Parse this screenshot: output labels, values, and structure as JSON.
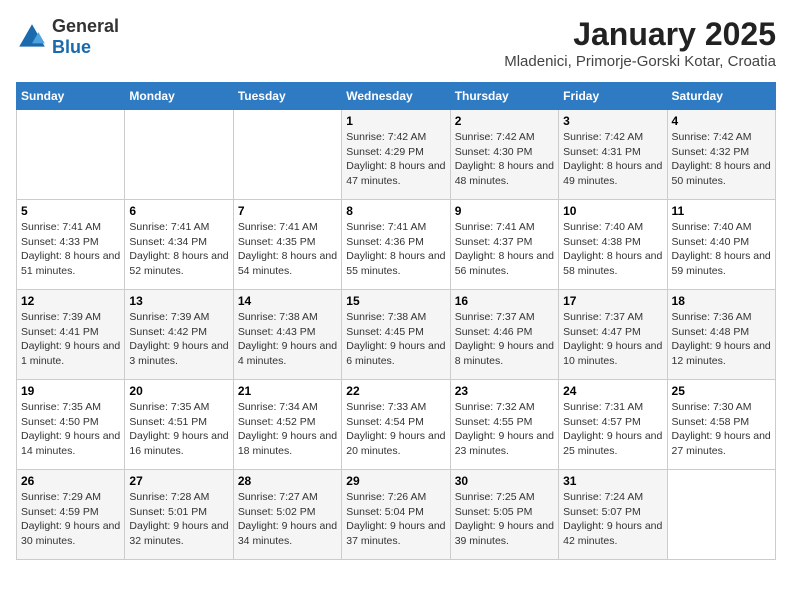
{
  "header": {
    "logo_general": "General",
    "logo_blue": "Blue",
    "month_title": "January 2025",
    "location": "Mladenici, Primorje-Gorski Kotar, Croatia"
  },
  "weekdays": [
    "Sunday",
    "Monday",
    "Tuesday",
    "Wednesday",
    "Thursday",
    "Friday",
    "Saturday"
  ],
  "weeks": [
    [
      {
        "day": "",
        "content": ""
      },
      {
        "day": "",
        "content": ""
      },
      {
        "day": "",
        "content": ""
      },
      {
        "day": "1",
        "content": "Sunrise: 7:42 AM\nSunset: 4:29 PM\nDaylight: 8 hours and 47 minutes."
      },
      {
        "day": "2",
        "content": "Sunrise: 7:42 AM\nSunset: 4:30 PM\nDaylight: 8 hours and 48 minutes."
      },
      {
        "day": "3",
        "content": "Sunrise: 7:42 AM\nSunset: 4:31 PM\nDaylight: 8 hours and 49 minutes."
      },
      {
        "day": "4",
        "content": "Sunrise: 7:42 AM\nSunset: 4:32 PM\nDaylight: 8 hours and 50 minutes."
      }
    ],
    [
      {
        "day": "5",
        "content": "Sunrise: 7:41 AM\nSunset: 4:33 PM\nDaylight: 8 hours and 51 minutes."
      },
      {
        "day": "6",
        "content": "Sunrise: 7:41 AM\nSunset: 4:34 PM\nDaylight: 8 hours and 52 minutes."
      },
      {
        "day": "7",
        "content": "Sunrise: 7:41 AM\nSunset: 4:35 PM\nDaylight: 8 hours and 54 minutes."
      },
      {
        "day": "8",
        "content": "Sunrise: 7:41 AM\nSunset: 4:36 PM\nDaylight: 8 hours and 55 minutes."
      },
      {
        "day": "9",
        "content": "Sunrise: 7:41 AM\nSunset: 4:37 PM\nDaylight: 8 hours and 56 minutes."
      },
      {
        "day": "10",
        "content": "Sunrise: 7:40 AM\nSunset: 4:38 PM\nDaylight: 8 hours and 58 minutes."
      },
      {
        "day": "11",
        "content": "Sunrise: 7:40 AM\nSunset: 4:40 PM\nDaylight: 8 hours and 59 minutes."
      }
    ],
    [
      {
        "day": "12",
        "content": "Sunrise: 7:39 AM\nSunset: 4:41 PM\nDaylight: 9 hours and 1 minute."
      },
      {
        "day": "13",
        "content": "Sunrise: 7:39 AM\nSunset: 4:42 PM\nDaylight: 9 hours and 3 minutes."
      },
      {
        "day": "14",
        "content": "Sunrise: 7:38 AM\nSunset: 4:43 PM\nDaylight: 9 hours and 4 minutes."
      },
      {
        "day": "15",
        "content": "Sunrise: 7:38 AM\nSunset: 4:45 PM\nDaylight: 9 hours and 6 minutes."
      },
      {
        "day": "16",
        "content": "Sunrise: 7:37 AM\nSunset: 4:46 PM\nDaylight: 9 hours and 8 minutes."
      },
      {
        "day": "17",
        "content": "Sunrise: 7:37 AM\nSunset: 4:47 PM\nDaylight: 9 hours and 10 minutes."
      },
      {
        "day": "18",
        "content": "Sunrise: 7:36 AM\nSunset: 4:48 PM\nDaylight: 9 hours and 12 minutes."
      }
    ],
    [
      {
        "day": "19",
        "content": "Sunrise: 7:35 AM\nSunset: 4:50 PM\nDaylight: 9 hours and 14 minutes."
      },
      {
        "day": "20",
        "content": "Sunrise: 7:35 AM\nSunset: 4:51 PM\nDaylight: 9 hours and 16 minutes."
      },
      {
        "day": "21",
        "content": "Sunrise: 7:34 AM\nSunset: 4:52 PM\nDaylight: 9 hours and 18 minutes."
      },
      {
        "day": "22",
        "content": "Sunrise: 7:33 AM\nSunset: 4:54 PM\nDaylight: 9 hours and 20 minutes."
      },
      {
        "day": "23",
        "content": "Sunrise: 7:32 AM\nSunset: 4:55 PM\nDaylight: 9 hours and 23 minutes."
      },
      {
        "day": "24",
        "content": "Sunrise: 7:31 AM\nSunset: 4:57 PM\nDaylight: 9 hours and 25 minutes."
      },
      {
        "day": "25",
        "content": "Sunrise: 7:30 AM\nSunset: 4:58 PM\nDaylight: 9 hours and 27 minutes."
      }
    ],
    [
      {
        "day": "26",
        "content": "Sunrise: 7:29 AM\nSunset: 4:59 PM\nDaylight: 9 hours and 30 minutes."
      },
      {
        "day": "27",
        "content": "Sunrise: 7:28 AM\nSunset: 5:01 PM\nDaylight: 9 hours and 32 minutes."
      },
      {
        "day": "28",
        "content": "Sunrise: 7:27 AM\nSunset: 5:02 PM\nDaylight: 9 hours and 34 minutes."
      },
      {
        "day": "29",
        "content": "Sunrise: 7:26 AM\nSunset: 5:04 PM\nDaylight: 9 hours and 37 minutes."
      },
      {
        "day": "30",
        "content": "Sunrise: 7:25 AM\nSunset: 5:05 PM\nDaylight: 9 hours and 39 minutes."
      },
      {
        "day": "31",
        "content": "Sunrise: 7:24 AM\nSunset: 5:07 PM\nDaylight: 9 hours and 42 minutes."
      },
      {
        "day": "",
        "content": ""
      }
    ]
  ]
}
